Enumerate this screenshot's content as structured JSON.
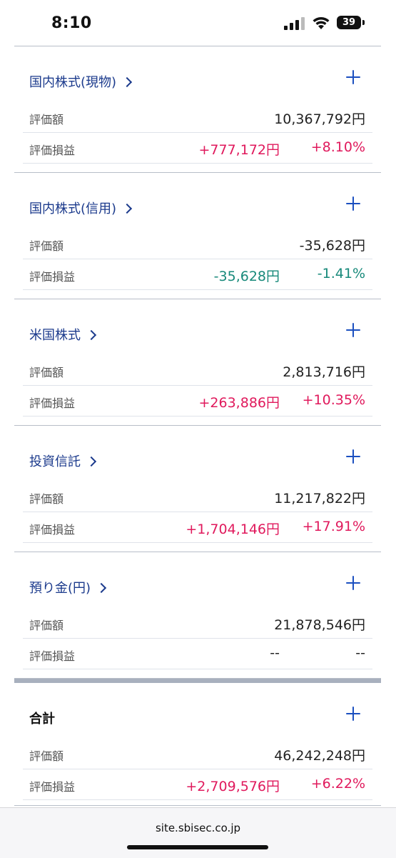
{
  "status_bar": {
    "time": "8:10",
    "battery": "39"
  },
  "labels": {
    "valuation": "評価額",
    "pnl": "評価損益"
  },
  "sections": [
    {
      "title": "国内株式(現物)",
      "valuation": "10,367,792円",
      "pnl_amount": "+777,172円",
      "pnl_percent": "+8.10%"
    },
    {
      "title": "国内株式(信用)",
      "valuation": "-35,628円",
      "pnl_amount": "-35,628円",
      "pnl_percent": "-1.41%"
    },
    {
      "title": "米国株式",
      "valuation": "2,813,716円",
      "pnl_amount": "+263,886円",
      "pnl_percent": "+10.35%"
    },
    {
      "title": "投資信託",
      "valuation": "11,217,822円",
      "pnl_amount": "+1,704,146円",
      "pnl_percent": "+17.91%"
    },
    {
      "title": "預り金(円)",
      "valuation": "21,878,546円",
      "pnl_amount": "--",
      "pnl_percent": "--"
    }
  ],
  "total": {
    "title": "合計",
    "valuation": "46,242,248円",
    "pnl_amount": "+2,709,576円",
    "pnl_percent": "+6.22%"
  },
  "browser": {
    "url": "site.sbisec.co.jp"
  },
  "colors": {
    "accent": "#1b3a8c",
    "positive": "#e0195c",
    "negative": "#17897a"
  }
}
